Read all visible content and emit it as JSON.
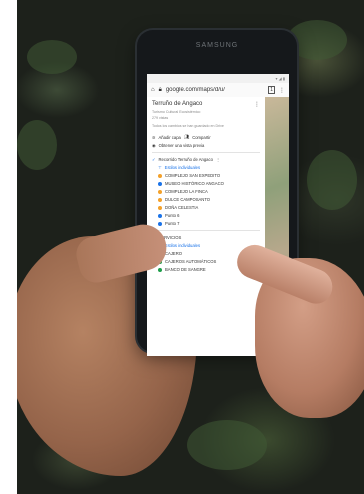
{
  "phone": {
    "brand": "SAMSUNG"
  },
  "browser": {
    "url": "google.com/maps/d/u/",
    "tab_count": "1"
  },
  "map_panel": {
    "title": "Terruño de Angaco",
    "description": "Turismo Cultural Ecosistémico",
    "views": "279 vistas",
    "saved_note": "Todos los cambios se han guardado en Drive",
    "actions": {
      "add_layer": "Añadir capa",
      "share": "Compartir",
      "preview": "Obtener una vista previa"
    },
    "layer1": {
      "name": "Recorrido Terruño de Angaco",
      "style": "Estilos individuales",
      "items": [
        {
          "label": "COMPLEJO SAN EXPEDITO",
          "color": "#f4a12a"
        },
        {
          "label": "MUSEO HISTÓRICO ANGACO",
          "color": "#1a73e8"
        },
        {
          "label": "COMPLEJO LA FINCA",
          "color": "#f4a12a"
        },
        {
          "label": "DULCE CAMPOSANTO",
          "color": "#f4a12a"
        },
        {
          "label": "DOÑA CELESTIA",
          "color": "#f4a12a"
        },
        {
          "label": "Punto 6",
          "color": "#1a73e8"
        },
        {
          "label": "Punto 7",
          "color": "#1a73e8"
        }
      ]
    },
    "layer2": {
      "name": "SERVICIOS",
      "style": "Estilos individuales",
      "items": [
        {
          "label": "CAJERO",
          "color": "#1e9e4a"
        },
        {
          "label": "CAJEROS AUTOMÁTICOS",
          "color": "#1e9e4a"
        },
        {
          "label": "BANCO DE SANGRE",
          "color": "#1e9e4a"
        }
      ]
    }
  }
}
